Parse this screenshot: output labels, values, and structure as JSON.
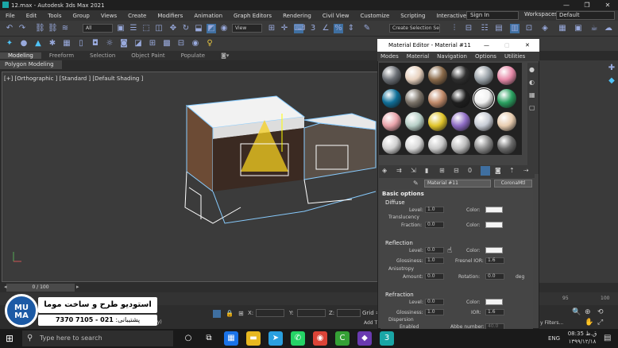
{
  "window": {
    "title": "12.max - Autodesk 3ds Max 2021",
    "buttons": [
      "—",
      "❐",
      "✕"
    ]
  },
  "menu": {
    "items": [
      "File",
      "Edit",
      "Tools",
      "Group",
      "Views",
      "Create",
      "Modifiers",
      "Animation",
      "Graph Editors",
      "Rendering",
      "Civil View",
      "Customize",
      "Scripting",
      "Interactive"
    ],
    "more": "»",
    "sign_in": "Sign In",
    "workspaces_label": "Workspaces:",
    "workspaces_value": "Default"
  },
  "toolbar": {
    "selection_filter": "All",
    "view_dropdown": "View",
    "selection_set": "Create Selection Se"
  },
  "ribbon": {
    "tabs": [
      "Modeling",
      "Freeform",
      "Selection",
      "Object Paint",
      "Populate"
    ],
    "sub": "Polygon Modeling"
  },
  "viewport": {
    "label": "[+] [Orthographic ] [Standard ] [Default Shading ]"
  },
  "timeline": {
    "slider": "0 / 100",
    "ticks": [
      "80",
      "95",
      "100"
    ]
  },
  "status": {
    "x_label": "X:",
    "y_label": "Y:",
    "z_label": "Z:",
    "grid_label": "Grid =",
    "add_time": "Add Ti",
    "key_filters": "y Filters...",
    "selected": "emily)"
  },
  "watermark": {
    "logo": "MU MA",
    "title": "استودیو طرح و ساخت موما",
    "phone_label": "پشتیبانی:",
    "phone": "021 - 7105 7370"
  },
  "taskbar": {
    "search": "Type here to search",
    "lang": "ENG",
    "time": "08:35 ق.ظ",
    "date": "۱۳۹۹/۱۲/۱۸"
  },
  "material_editor": {
    "title": "Material Editor - Material #11",
    "menu": [
      "Modes",
      "Material",
      "Navigation",
      "Options",
      "Utilities"
    ],
    "material_name": "Material #11",
    "material_type": "CoronaMtl",
    "sample_colors": [
      [
        "#6b6f75",
        "#e8d2bf",
        "#8a6a4a",
        "#2f2f2f",
        "#9aa2a8",
        "#e78aa9"
      ],
      [
        "#0f6f98",
        "#7a7268",
        "#c08a6a",
        "#1e1e1e",
        "#f0f0f0",
        "#2aa060"
      ],
      [
        "#e9a3aa",
        "#b8d0c8",
        "#e0c42a",
        "#8e6cc4",
        "#c8cdd6",
        "#e8cdb0"
      ],
      [
        "#d0d0d0",
        "#d8d8d8",
        "#c8c8c8",
        "#bcbcbc",
        "#8a8a8a",
        "#6a6a6a"
      ]
    ],
    "rollout": "Basic options",
    "diffuse": {
      "header": "Diffuse",
      "level_label": "Level:",
      "level": "1.0",
      "color_label": "Color:",
      "translucency": "Translucency",
      "fraction_label": "Fraction:",
      "fraction": "0.0",
      "color2_label": "Color:"
    },
    "reflection": {
      "header": "Reflection",
      "level_label": "Level:",
      "level": "0.0",
      "color_label": "Color:",
      "gloss_label": "Glossiness:",
      "gloss": "1.0",
      "ior_label": "Fresnel IOR:",
      "ior": "1.6",
      "aniso": "Anisotropy",
      "amount_label": "Amount:",
      "amount": "0.0",
      "rot_label": "Rotation:",
      "rot": "0.0",
      "deg": "deg"
    },
    "refraction": {
      "header": "Refraction",
      "level_label": "Level:",
      "level": "0.0",
      "color_label": "Color:",
      "gloss_label": "Glossiness:",
      "gloss": "1.0",
      "ior_label": "IOR:",
      "ior": "1.6",
      "dispersion": "Dispersion",
      "enabled": "Enabled",
      "abbe_label": "Abbe number:",
      "abbe": "40.0"
    }
  }
}
